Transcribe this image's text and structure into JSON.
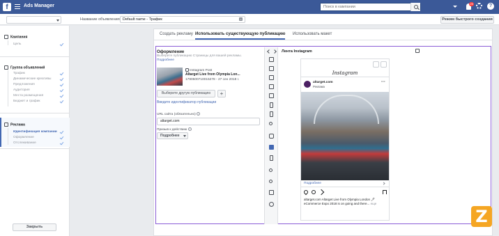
{
  "topbar": {
    "app_title": "Ads Manager",
    "search_placeholder": "Поиск в кампании",
    "notification_count": "20"
  },
  "subbar": {
    "ad_name_label": "Название объявления",
    "ad_name_value": "Default name - Трафик",
    "quick_create_label": "Режим быстрого создания"
  },
  "sidebar": {
    "campaign": {
      "title": "Кампания",
      "items": [
        "Цель"
      ]
    },
    "adset": {
      "title": "Группа объявлений",
      "items": [
        "Трафик",
        "Динамические креативы",
        "Предложения",
        "Аудитория",
        "Места размещения",
        "Бюджет и график"
      ]
    },
    "ad": {
      "title": "Реклама",
      "items": [
        "Идентификация компании",
        "Оформление",
        "Отслеживание"
      ]
    },
    "close_label": "Закрыть"
  },
  "tabs": [
    {
      "label": "Создать рекламу"
    },
    {
      "label": "Использовать существующую публикацию"
    },
    {
      "label": "Использовать макет"
    }
  ],
  "format": {
    "title": "Оформление",
    "subtitle": "Выберите публикацию Страницы для вашей рекламы.",
    "more_link": "Подробнее",
    "post_type": "Instagram Post",
    "post_title": "Altarget Live from Olympia Lon...",
    "post_meta": "1790500710015278 - 27 сен 2018 г.",
    "choose_post_label": "Выберите другую публикацию",
    "enter_id_link": "Введите идентификатор публикации",
    "url_label": "URL сайта (обязательно)",
    "url_value": "altarget.com",
    "cta_label": "Призыв к действию",
    "cta_value": "Подробнее"
  },
  "preview": {
    "title": "Лента Instagram",
    "ig_logo": "Instagram",
    "account_name": "altarget.com",
    "sponsored_label": "Реклама",
    "more_label": "Подробнее",
    "caption": "altarget.com Altarget Live from Olympia London 🖊 eCommerce Expo 2018 is on going and there...",
    "caption_more": "еще"
  },
  "colors": {
    "brand": "#3b5998",
    "accent": "#4267b2",
    "selection_outline": "#8a5cd6"
  }
}
